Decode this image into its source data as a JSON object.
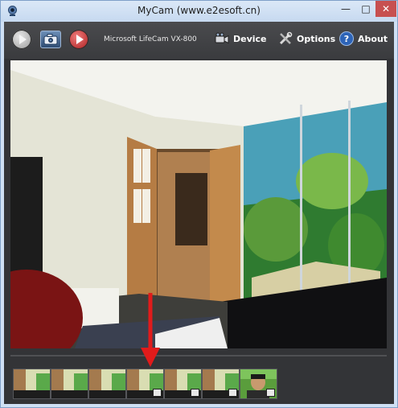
{
  "window": {
    "title": "MyCam (www.e2esoft.cn)",
    "controls": {
      "minimize": "—",
      "maximize": "□",
      "close": "✕"
    }
  },
  "toolbar": {
    "camera_name": "Microsoft LifeCam VX-800",
    "device_label": "Device",
    "options_label": "Options",
    "about_label": "About",
    "about_icon_glyph": "?"
  },
  "icons": {
    "app": "webcam-icon",
    "play": "play-icon",
    "snapshot": "camera-snapshot-icon",
    "record": "record-icon",
    "device": "video-camera-icon",
    "options": "tools-icon",
    "about": "help-icon"
  },
  "thumbnails": [
    {
      "id": 1,
      "media": "photo"
    },
    {
      "id": 2,
      "media": "photo"
    },
    {
      "id": 3,
      "media": "photo"
    },
    {
      "id": 4,
      "media": "video"
    },
    {
      "id": 5,
      "media": "video"
    },
    {
      "id": 6,
      "media": "video"
    },
    {
      "id": 7,
      "media": "video"
    }
  ],
  "colors": {
    "record": "#c62828",
    "arrow": "#e11b1b",
    "about": "#2d64b8"
  }
}
